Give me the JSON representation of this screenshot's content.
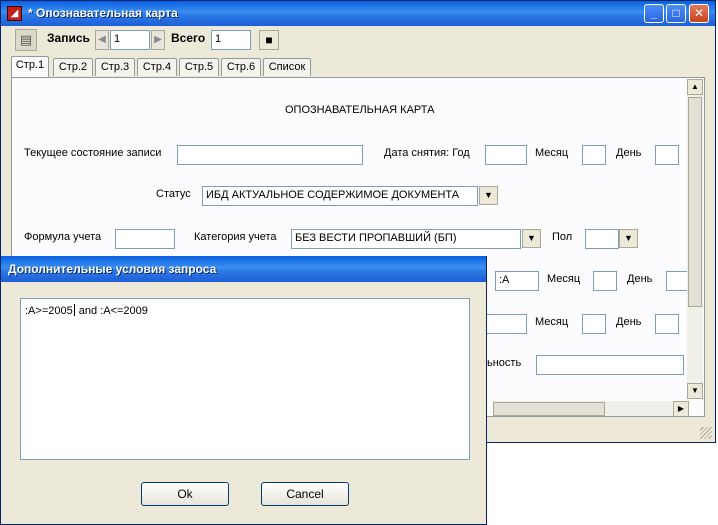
{
  "window": {
    "title": "* Опознавательная карта",
    "controls": {
      "minimize": "_",
      "maximize": "□",
      "close": "✕"
    }
  },
  "toolbar": {
    "record_label": "Запись",
    "record_value": "1",
    "total_label": "Всего",
    "total_value": "1"
  },
  "tabs": [
    "Стр.1",
    "Стр.2",
    "Стр.3",
    "Стр.4",
    "Стр.5",
    "Стр.6",
    "Список"
  ],
  "form": {
    "heading": "ОПОЗНАВАТЕЛЬНАЯ  КАРТА",
    "current_state_label": "Текущее состояние записи",
    "current_state_value": "",
    "removal_date_label": "Дата снятия: Год",
    "month_label": "Месяц",
    "day_label": "День",
    "status_label": "Статус",
    "status_value": "ИБД  АКТУАЛЬНОЕ СОДЕРЖИМОЕ ДОКУМЕНТА",
    "formula_label": "Формула учета",
    "category_label": "Категория учета",
    "category_value": "БЕЗ ВЕСТИ ПРОПАВШИЙ (БП)",
    "sex_label": "Пол",
    "row4_field_value": ":A",
    "row4_month_label": "Месяц",
    "row4_day_label": "День",
    "row5_month_label": "Месяц",
    "row5_day_label": "День",
    "partial_label": "ьность"
  },
  "dialog": {
    "title": "Дополнительные условия запроса",
    "query_before_caret": ":A>=2005",
    "query_after_caret": " and :A<=2009",
    "ok_label": "Ok",
    "cancel_label": "Cancel"
  },
  "colors": {
    "titlebar": "#2d7be6",
    "window_bg": "#ece9d8",
    "field_border": "#7f9db9"
  }
}
